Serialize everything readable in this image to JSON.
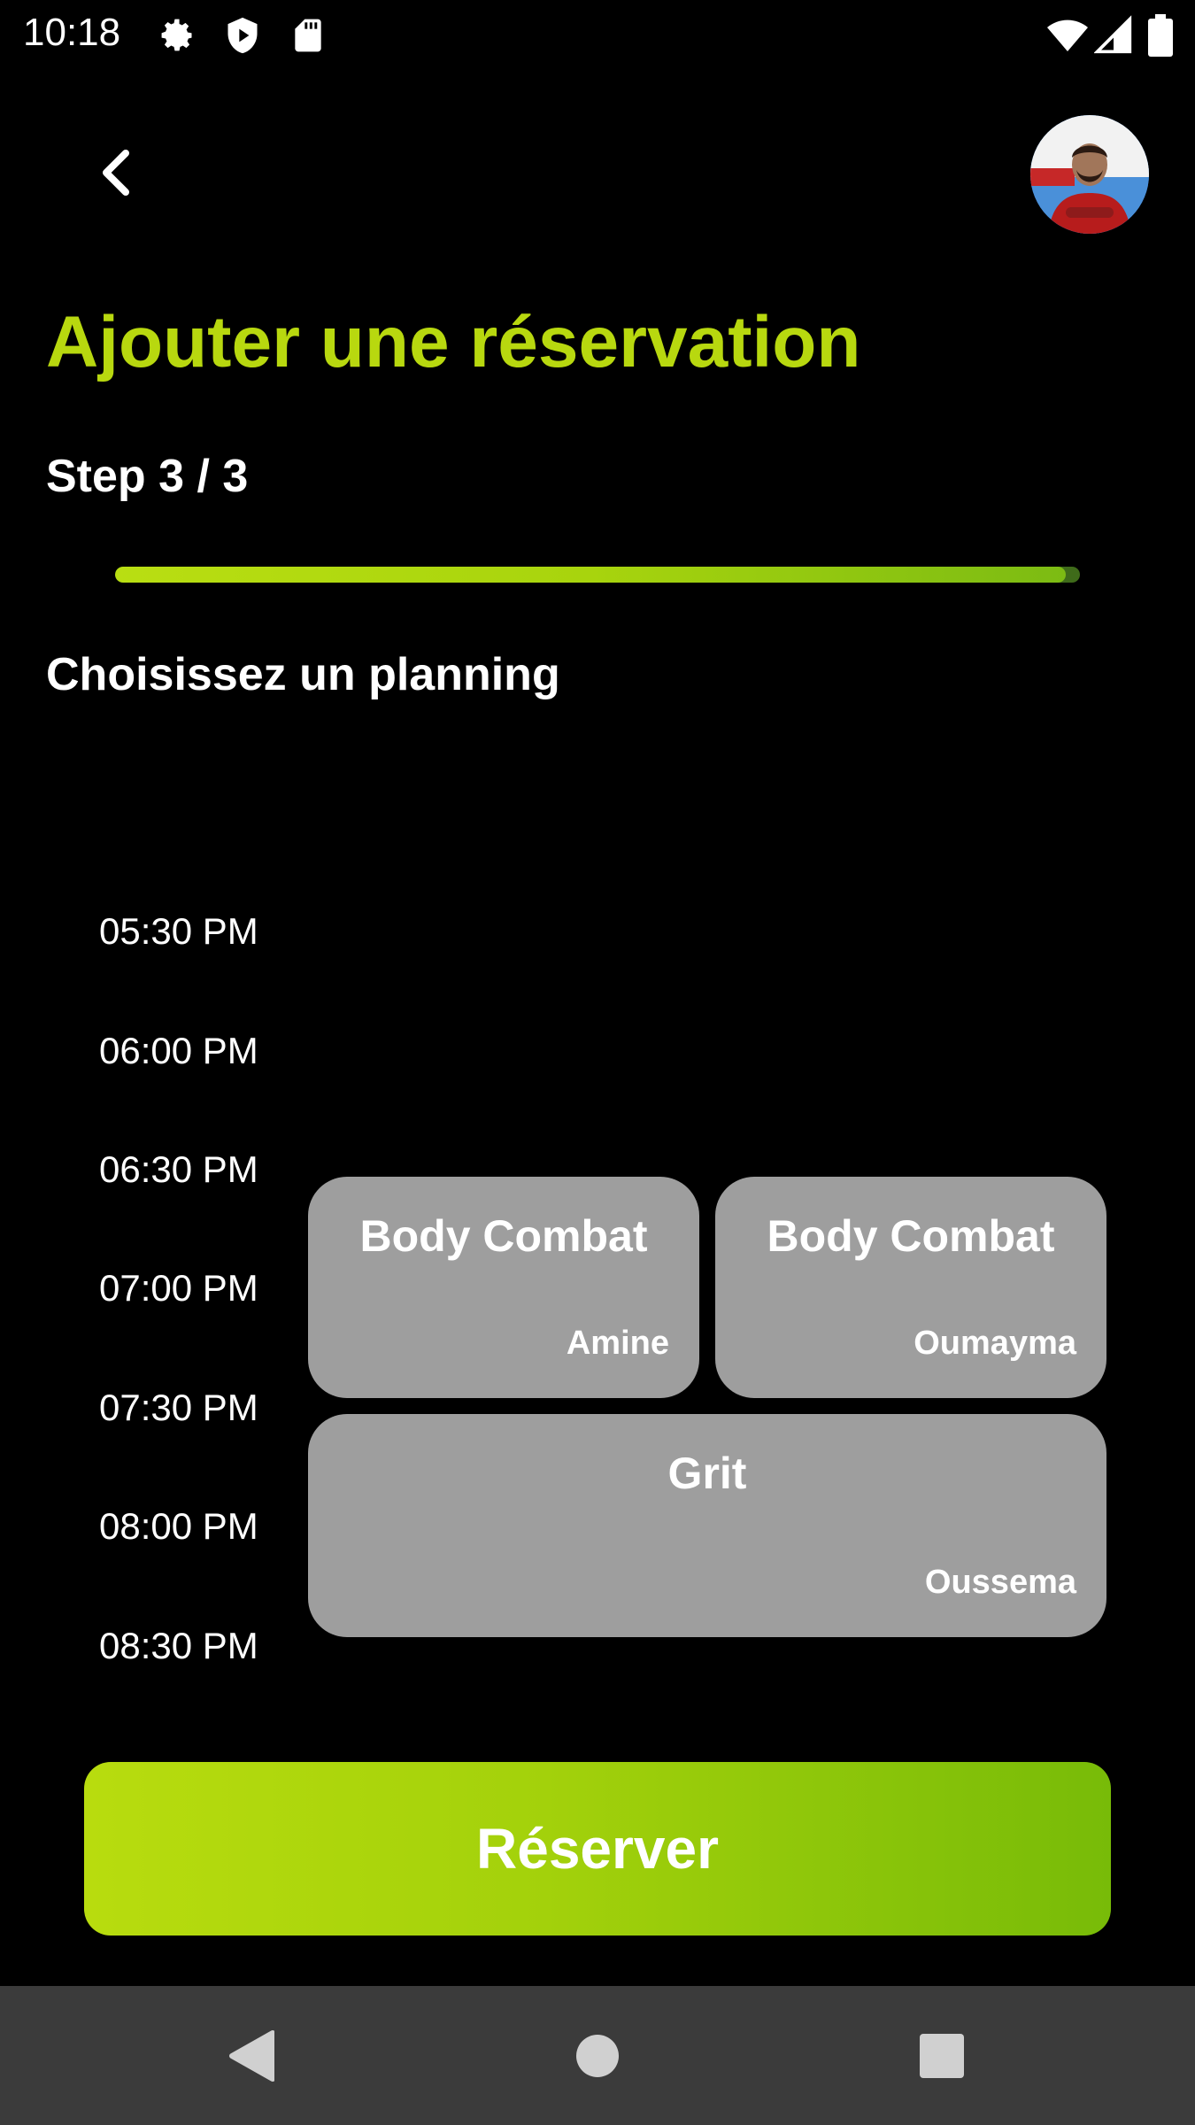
{
  "status_bar": {
    "time": "10:18",
    "icons": [
      "gear-icon",
      "shield-play-icon",
      "sd-card-icon",
      "wifi-icon",
      "signal-icon",
      "battery-icon"
    ]
  },
  "header": {
    "back_icon": "chevron-left-icon",
    "avatar_icon": "user-avatar"
  },
  "page": {
    "title": "Ajouter une réservation",
    "step": "Step 3 / 3",
    "progress": 1.0,
    "section_title": "Choisissez un planning"
  },
  "schedule": {
    "times": [
      "05:30 PM",
      "06:00 PM",
      "06:30 PM",
      "07:00 PM",
      "07:30 PM",
      "08:00 PM",
      "08:30 PM"
    ],
    "events": [
      {
        "title": "Body Combat",
        "coach": "Amine"
      },
      {
        "title": "Body Combat",
        "coach": "Oumayma"
      },
      {
        "title": "Grit",
        "coach": "Oussema"
      }
    ]
  },
  "actions": {
    "reserve_label": "Réserver"
  },
  "navbar": {
    "icons": [
      "back-triangle-icon",
      "home-circle-icon",
      "recents-square-icon"
    ]
  },
  "colors": {
    "accent": "#b8d80f",
    "event_bg": "#9e9e9e",
    "background": "#000000",
    "navbar_bg": "#3b3b3b"
  }
}
